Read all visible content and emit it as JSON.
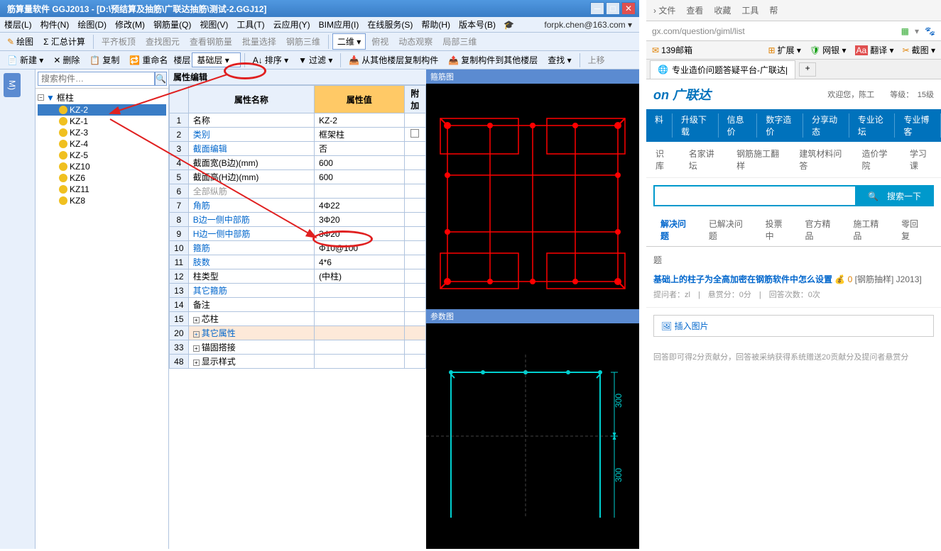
{
  "titlebar": "筋算量软件 GGJ2013 - [D:\\预结算及抽筋\\广联达抽筋\\测试-2.GGJ12]",
  "menu": [
    "楼层(L)",
    "构件(N)",
    "绘图(D)",
    "修改(M)",
    "钢筋量(Q)",
    "视图(V)",
    "工具(T)",
    "云应用(Y)",
    "BIM应用(I)",
    "在线服务(S)",
    "帮助(H)",
    "版本号(B)"
  ],
  "user_email": "forpk.chen@163.com ▾",
  "toolbar1": [
    "绘图",
    "Σ 汇总计算",
    "平齐板顶",
    "查找图元",
    "查看钢筋量",
    "批量选择",
    "钢筋三维",
    "二维 ▾",
    "俯视",
    "动态观察",
    "局部三维"
  ],
  "toolbar2": {
    "new": "新建 ▾",
    "del": "删除",
    "copy": "复制",
    "rename": "重命名",
    "floor_label": "楼层",
    "floor_value": "基础层",
    "sort": "排序 ▾",
    "filter": "过滤 ▾",
    "copy_from": "从其他楼层复制构件",
    "copy_to": "复制构件到其他楼层",
    "search": "查找 ▾",
    "upload": "上移"
  },
  "search_placeholder": "搜索构件…",
  "tree": {
    "root": "框柱",
    "selected": "KZ-2",
    "items": [
      "KZ-2",
      "KZ-1",
      "KZ-3",
      "KZ-4",
      "KZ-5",
      "KZ10",
      "KZ6",
      "KZ11",
      "KZ8"
    ]
  },
  "prop_header": "属性编辑",
  "prop_cols": {
    "name": "属性名称",
    "val": "属性值",
    "add": "附加"
  },
  "props": [
    {
      "n": "1",
      "name": "名称",
      "val": "KZ-2",
      "link": false
    },
    {
      "n": "2",
      "name": "类别",
      "val": "框架柱",
      "link": true
    },
    {
      "n": "3",
      "name": "截面编辑",
      "val": "否",
      "link": true
    },
    {
      "n": "4",
      "name": "截面宽(B边)(mm)",
      "val": "600",
      "link": false
    },
    {
      "n": "5",
      "name": "截面高(H边)(mm)",
      "val": "600",
      "link": false
    },
    {
      "n": "6",
      "name": "全部纵筋",
      "val": "",
      "link": false,
      "gray": true
    },
    {
      "n": "7",
      "name": "角筋",
      "val": "4Φ22",
      "link": true
    },
    {
      "n": "8",
      "name": "B边一侧中部筋",
      "val": "3Φ20",
      "link": true
    },
    {
      "n": "9",
      "name": "H边一侧中部筋",
      "val": "3Φ20",
      "link": true
    },
    {
      "n": "10",
      "name": "箍筋",
      "val": "Φ10@100",
      "link": true
    },
    {
      "n": "11",
      "name": "肢数",
      "val": "4*6",
      "link": true
    },
    {
      "n": "12",
      "name": "柱类型",
      "val": "(中柱)",
      "link": false
    },
    {
      "n": "13",
      "name": "其它箍筋",
      "val": "",
      "link": true
    },
    {
      "n": "14",
      "name": "备注",
      "val": "",
      "link": false
    }
  ],
  "prop_groups": [
    {
      "n": "15",
      "name": "芯柱",
      "hl": false
    },
    {
      "n": "20",
      "name": "其它属性",
      "hl": true
    },
    {
      "n": "33",
      "name": "锚固搭接",
      "hl": false
    },
    {
      "n": "48",
      "name": "显示样式",
      "hl": false
    }
  ],
  "diagram1_title": "箍筋图",
  "diagram2_title": "参数图",
  "dim_300": "300",
  "browser": {
    "menu": [
      "› 文件",
      "查看",
      "收藏",
      "工具",
      "帮"
    ],
    "url": "gx.com/question/giml/list",
    "ext": [
      "139邮箱",
      "扩展 ▾",
      "网银 ▾",
      "翻译 ▾",
      "截图 ▾"
    ],
    "tab": "专业造价问题答疑平台-广联达|",
    "logo": "on 广联达",
    "welcome": "欢迎您，陈工　　等级：　15级",
    "nav": [
      "料",
      "升级下载",
      "信息价",
      "数字造价",
      "分享动态",
      "专业论坛",
      "专业博客"
    ],
    "subnav": [
      "识库",
      "名家讲坛",
      "钢筋施工翻样",
      "建筑材料问答",
      "造价学院",
      "学习课"
    ],
    "search_btn": "🔍　搜索一下",
    "tabs": [
      "解决问题",
      "已解决问题",
      "投票中",
      "官方精品",
      "施工精品",
      "零回复"
    ],
    "q_cat": "题",
    "q_title": "基础上的柱子为全高加密在钢筋软件中怎么设置",
    "q_reward": "0",
    "q_tag": "[钢筋抽样] J2013]",
    "q_meta": "提问者：zl　|　悬赏分：0分　|　回答次数：0次",
    "insert": "插入图片",
    "hint": "回答即可得2分贡献分，回答被采纳获得系统赠送20贡献分及提问者悬赏分"
  }
}
